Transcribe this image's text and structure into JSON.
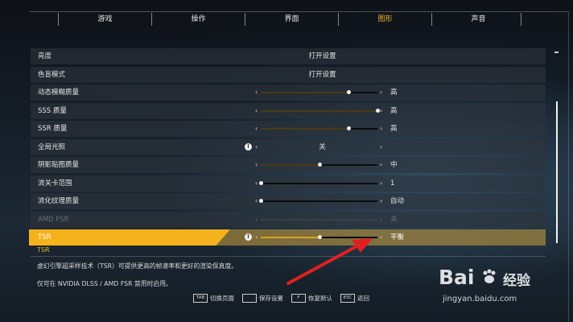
{
  "tabs": [
    {
      "label": "游戏",
      "active": false
    },
    {
      "label": "操作",
      "active": false
    },
    {
      "label": "界面",
      "active": false
    },
    {
      "label": "图形",
      "active": true
    },
    {
      "label": "声音",
      "active": false
    }
  ],
  "settings": [
    {
      "label": "亮度",
      "kind": "button",
      "value": "打开设置"
    },
    {
      "label": "色盲模式",
      "kind": "button",
      "value": "打开设置"
    },
    {
      "label": "动态模糊质量",
      "kind": "slider",
      "level": 0.75,
      "value": "高"
    },
    {
      "label": "SSS 质量",
      "kind": "slider",
      "level": 1.0,
      "value": "高"
    },
    {
      "label": "SSR 质量",
      "kind": "slider",
      "level": 0.75,
      "value": "高"
    },
    {
      "label": "全局光照",
      "kind": "select",
      "value": "关",
      "info": true
    },
    {
      "label": "阴影贴图质量",
      "kind": "slider",
      "level": 0.5,
      "value": "中"
    },
    {
      "label": "流关卡范围",
      "kind": "slider",
      "level": 0.0,
      "value": "1"
    },
    {
      "label": "流化纹理质量",
      "kind": "slider",
      "level": 0.0,
      "value": "自动"
    },
    {
      "label": "AMD FSR",
      "kind": "slider",
      "level": 0.0,
      "value": "关",
      "disabled": true
    },
    {
      "label": "TSR",
      "kind": "slider",
      "level": 0.5,
      "value": "平衡",
      "selected": true,
      "info": true
    }
  ],
  "description": {
    "title": "TSR",
    "line1": "虚幻引擎超采样技术（TSR）可提供更高的帧速率和更好的渲染保真度。",
    "line2": "仅可在 NVIDIA DLSS / AMD FSR 禁用时启用。"
  },
  "footer": [
    {
      "key": "TAB",
      "label": "切换页面"
    },
    {
      "key": "",
      "label": "保存设置"
    },
    {
      "key": "F",
      "label": "恢复默认"
    },
    {
      "key": "ESC",
      "label": "返回"
    }
  ],
  "watermark": {
    "brand": "Bai",
    "brand_suffix": "经验",
    "url": "jingyan.baidu.com"
  },
  "colors": {
    "accent": "#f6b21c",
    "track_dark": "#4b3a12",
    "track_active": "#d9a227"
  }
}
